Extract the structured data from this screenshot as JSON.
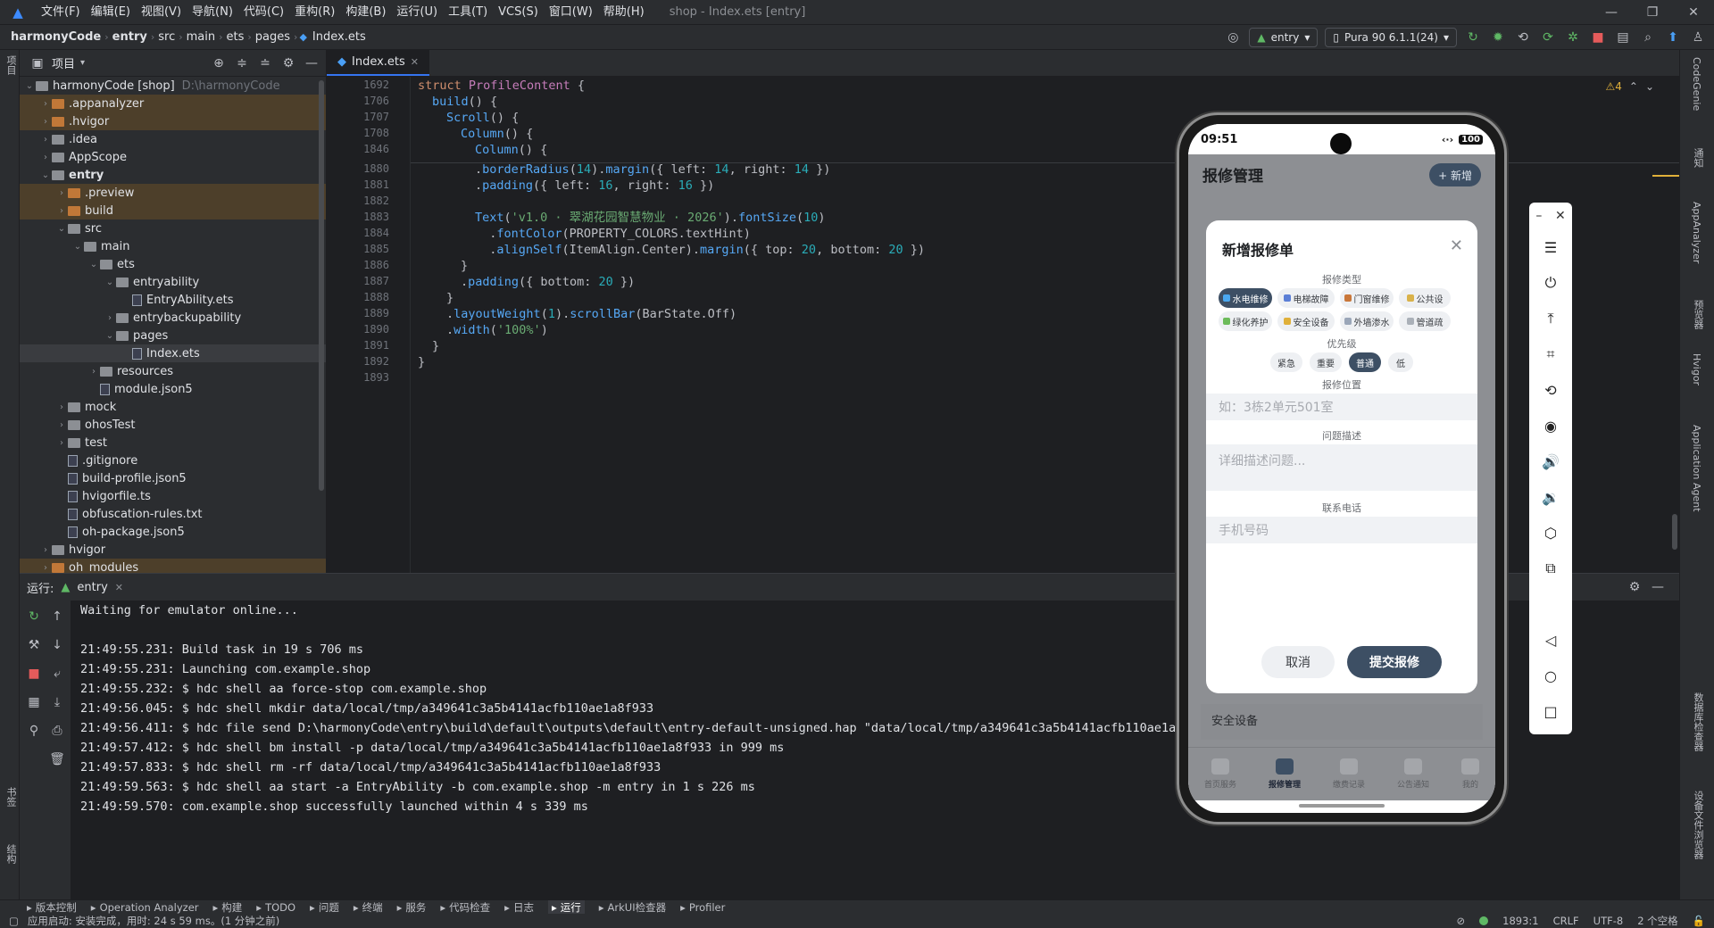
{
  "menu": {
    "items": [
      "文件(F)",
      "编辑(E)",
      "视图(V)",
      "导航(N)",
      "代码(C)",
      "重构(R)",
      "构建(B)",
      "运行(U)",
      "工具(T)",
      "VCS(S)",
      "窗口(W)",
      "帮助(H)"
    ],
    "title": "shop - Index.ets [entry]"
  },
  "nav": {
    "crumbs": [
      "harmonyCode",
      "entry",
      "src",
      "main",
      "ets",
      "pages",
      "Index.ets"
    ],
    "config": "entry",
    "device": "Pura 90 6.1.1(24)"
  },
  "project": {
    "title": "项目",
    "left_tab": "项目"
  },
  "tree": [
    {
      "label": "harmonyCode [shop]",
      "dim": "D:\\harmonyCode",
      "depth": 0,
      "arrow": "v",
      "kind": "fold"
    },
    {
      "label": ".appanalyzer",
      "depth": 1,
      "arrow": ">",
      "kind": "ofold",
      "hl": true
    },
    {
      "label": ".hvigor",
      "depth": 1,
      "arrow": ">",
      "kind": "ofold",
      "hl": true
    },
    {
      "label": ".idea",
      "depth": 1,
      "arrow": ">",
      "kind": "fold"
    },
    {
      "label": "AppScope",
      "depth": 1,
      "arrow": ">",
      "kind": "fold"
    },
    {
      "label": "entry",
      "depth": 1,
      "arrow": "v",
      "kind": "fold",
      "bold": true
    },
    {
      "label": ".preview",
      "depth": 2,
      "arrow": ">",
      "kind": "ofold",
      "hl": true
    },
    {
      "label": "build",
      "depth": 2,
      "arrow": ">",
      "kind": "ofold",
      "hl": true
    },
    {
      "label": "src",
      "depth": 2,
      "arrow": "v",
      "kind": "fold"
    },
    {
      "label": "main",
      "depth": 3,
      "arrow": "v",
      "kind": "fold"
    },
    {
      "label": "ets",
      "depth": 4,
      "arrow": "v",
      "kind": "fold"
    },
    {
      "label": "entryability",
      "depth": 5,
      "arrow": "v",
      "kind": "fold"
    },
    {
      "label": "EntryAbility.ets",
      "depth": 6,
      "arrow": "",
      "kind": "file"
    },
    {
      "label": "entrybackupability",
      "depth": 5,
      "arrow": ">",
      "kind": "fold"
    },
    {
      "label": "pages",
      "depth": 5,
      "arrow": "v",
      "kind": "fold"
    },
    {
      "label": "Index.ets",
      "depth": 6,
      "arrow": "",
      "kind": "file"
    },
    {
      "label": "resources",
      "depth": 4,
      "arrow": ">",
      "kind": "fold"
    },
    {
      "label": "module.json5",
      "depth": 4,
      "arrow": "",
      "kind": "file"
    },
    {
      "label": "mock",
      "depth": 2,
      "arrow": ">",
      "kind": "fold"
    },
    {
      "label": "ohosTest",
      "depth": 2,
      "arrow": ">",
      "kind": "fold"
    },
    {
      "label": "test",
      "depth": 2,
      "arrow": ">",
      "kind": "fold"
    },
    {
      "label": ".gitignore",
      "depth": 2,
      "arrow": "",
      "kind": "file"
    },
    {
      "label": "build-profile.json5",
      "depth": 2,
      "arrow": "",
      "kind": "file"
    },
    {
      "label": "hvigorfile.ts",
      "depth": 2,
      "arrow": "",
      "kind": "file"
    },
    {
      "label": "obfuscation-rules.txt",
      "depth": 2,
      "arrow": "",
      "kind": "file"
    },
    {
      "label": "oh-package.json5",
      "depth": 2,
      "arrow": "",
      "kind": "file"
    },
    {
      "label": "hvigor",
      "depth": 1,
      "arrow": ">",
      "kind": "fold"
    },
    {
      "label": "oh_modules",
      "depth": 1,
      "arrow": ">",
      "kind": "ofold",
      "hl": true
    }
  ],
  "editor": {
    "tab": "Index.ets",
    "warnings": "⚠4"
  },
  "code": [
    {
      "n": "1692",
      "h": "<span class='k'>struct</span> <span class='t'>ProfileContent</span> {",
      "i": 0
    },
    {
      "n": "1706",
      "h": "<span class='f'>build</span>() {",
      "i": 1
    },
    {
      "n": "1707",
      "h": "<span class='f'>Scroll</span>() {",
      "i": 2
    },
    {
      "n": "1708",
      "h": "<span class='f'>Column</span>() {",
      "i": 3
    },
    {
      "n": "1846",
      "h": "<span class='f'>Column</span>() {",
      "i": 4
    },
    {
      "n": "1880",
      "h": ".<span class='f'>borderRadius</span>(<span class='n'>14</span>).<span class='f'>margin</span>({ left: <span class='n'>14</span>, right: <span class='n'>14</span> })",
      "i": 4
    },
    {
      "n": "1881",
      "h": ".<span class='f'>padding</span>({ left: <span class='n'>16</span>, right: <span class='n'>16</span> })",
      "i": 4
    },
    {
      "n": "1882",
      "h": "",
      "i": 0
    },
    {
      "n": "1883",
      "h": "<span class='f'>Text</span>(<span class='s'>'v1.0 · 翠湖花园智慧物业 · 2026'</span>).<span class='f'>fontSize</span>(<span class='n'>10</span>)",
      "i": 4
    },
    {
      "n": "1884",
      "h": "  .<span class='f'>fontColor</span>(PROPERTY_COLORS.textHint)",
      "i": 4
    },
    {
      "n": "1885",
      "h": "  .<span class='f'>alignSelf</span>(ItemAlign.Center).<span class='f'>margin</span>({ top: <span class='n'>20</span>, bottom: <span class='n'>20</span> })",
      "i": 4
    },
    {
      "n": "1886",
      "h": "}",
      "i": 3
    },
    {
      "n": "1887",
      "h": ".<span class='f'>padding</span>({ bottom: <span class='n'>20</span> })",
      "i": 3
    },
    {
      "n": "1888",
      "h": "}",
      "i": 2
    },
    {
      "n": "1889",
      "h": ".<span class='f'>layoutWeight</span>(<span class='n'>1</span>).<span class='f'>scrollBar</span>(BarState.Off)",
      "i": 2
    },
    {
      "n": "1890",
      "h": ".<span class='f'>width</span>(<span class='s'>'100%'</span>)",
      "i": 2
    },
    {
      "n": "1891",
      "h": "}",
      "i": 1
    },
    {
      "n": "1892",
      "h": "}",
      "i": 0
    },
    {
      "n": "1893",
      "h": "",
      "i": 0
    }
  ],
  "run": {
    "label": "运行:",
    "tab": "entry",
    "lines": [
      "Waiting for emulator online...",
      "",
      "21:49:55.231: Build task in 19 s 706 ms",
      "21:49:55.231: Launching com.example.shop",
      "21:49:55.232: $ hdc shell aa force-stop com.example.shop",
      "21:49:56.045: $ hdc shell mkdir data/local/tmp/a349641c3a5b4141acfb110ae1a8f933",
      "21:49:56.411: $ hdc file send D:\\harmonyCode\\entry\\build\\default\\outputs\\default\\entry-default-unsigned.hap \"data/local/tmp/a349641c3a5b4141acfb110ae1a8f93",
      "21:49:57.412: $ hdc shell bm install -p data/local/tmp/a349641c3a5b4141acfb110ae1a8f933 in 999 ms",
      "21:49:57.833: $ hdc shell rm -rf data/local/tmp/a349641c3a5b4141acfb110ae1a8f933",
      "21:49:59.563: $ hdc shell aa start -a EntryAbility -b com.example.shop -m entry in 1 s 226 ms",
      "21:49:59.570: com.example.shop successfully launched within 4 s 339 ms"
    ]
  },
  "toolwindows": [
    "版本控制",
    "Operation Analyzer",
    "构建",
    "TODO",
    "问题",
    "终端",
    "服务",
    "代码检查",
    "日志",
    "运行",
    "ArkUI检查器",
    "Profiler"
  ],
  "status": {
    "left": "应用启动: 安装完成，用时: 24 s 59 ms。(1 分钟之前)",
    "pos": "1893:1",
    "eol": "CRLF",
    "enc": "UTF-8",
    "indent": "2 个空格"
  },
  "right_stripe": [
    "CodeGenie",
    "通知",
    "AppAnalyzer",
    "预览器",
    "Hvigor",
    "Application Agent",
    "数据库检查器",
    "设备文件浏览器"
  ],
  "left_stripe_bottom": [
    "书签",
    "结构"
  ],
  "phone": {
    "time": "09:51",
    "battery": "100",
    "header_title": "报修管理",
    "header_add": "+ 新增",
    "dialog": {
      "title": "新增报修单",
      "type_label": "报修类型",
      "types_row1": [
        {
          "t": "水电维修",
          "c": "#4aa8f0"
        },
        {
          "t": "电梯故障",
          "c": "#5b7fd6"
        },
        {
          "t": "门窗维修",
          "c": "#c9773a"
        },
        {
          "t": "公共设",
          "c": "#d9b24a"
        }
      ],
      "types_row2": [
        {
          "t": "绿化养护",
          "c": "#6cbb5a"
        },
        {
          "t": "安全设备",
          "c": "#e0b03a"
        },
        {
          "t": "外墙渗水",
          "c": "#9aa6b8"
        },
        {
          "t": "管道疏",
          "c": "#aab0b8"
        }
      ],
      "priority_label": "优先级",
      "priorities": [
        "紧急",
        "重要",
        "普通",
        "低"
      ],
      "location_label": "报修位置",
      "location_ph": "如：3栋2单元501室",
      "desc_label": "问题描述",
      "desc_ph": "详细描述问题...",
      "phone_label": "联系电话",
      "phone_ph": "手机号码",
      "cancel": "取消",
      "submit": "提交报修"
    },
    "bg_card": "安全设备",
    "tabs": [
      "首页服务",
      "报修管理",
      "缴费记录",
      "公告通知",
      "我的"
    ]
  }
}
